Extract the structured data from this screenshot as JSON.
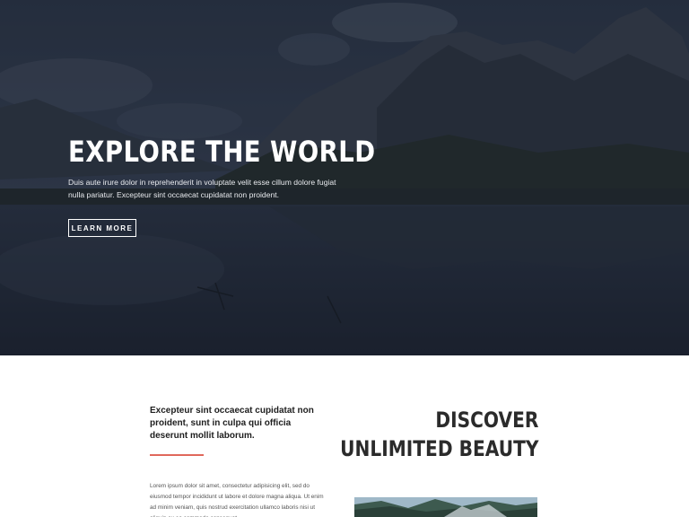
{
  "hero": {
    "title": "EXPLORE THE WORLD",
    "text": "Duis aute irure dolor in reprehenderit in voluptate velit esse cillum dolore fugiat nulla pariatur. Excepteur sint occaecat cupidatat non proident.",
    "button_label": "LEARN MORE"
  },
  "content": {
    "lead": "Excepteur sint occaecat cupidatat non proident, sunt in culpa qui officia deserunt mollit laborum.",
    "body": "Lorem ipsum dolor sit amet, consectetur adipisicing elit, sed do eiusmod tempor incididunt ut labore et dolore magna aliqua. Ut enim ad minim veniam, quis nostrud exercitation ullamco laboris nisi ut aliquip ex ea commodo consequat.",
    "heading_line1": "DISCOVER",
    "heading_line2": "UNLIMITED BEAUTY"
  },
  "colors": {
    "accent": "#e0685c",
    "hero_overlay": "#1f2733",
    "heading": "#2b2b2b"
  }
}
